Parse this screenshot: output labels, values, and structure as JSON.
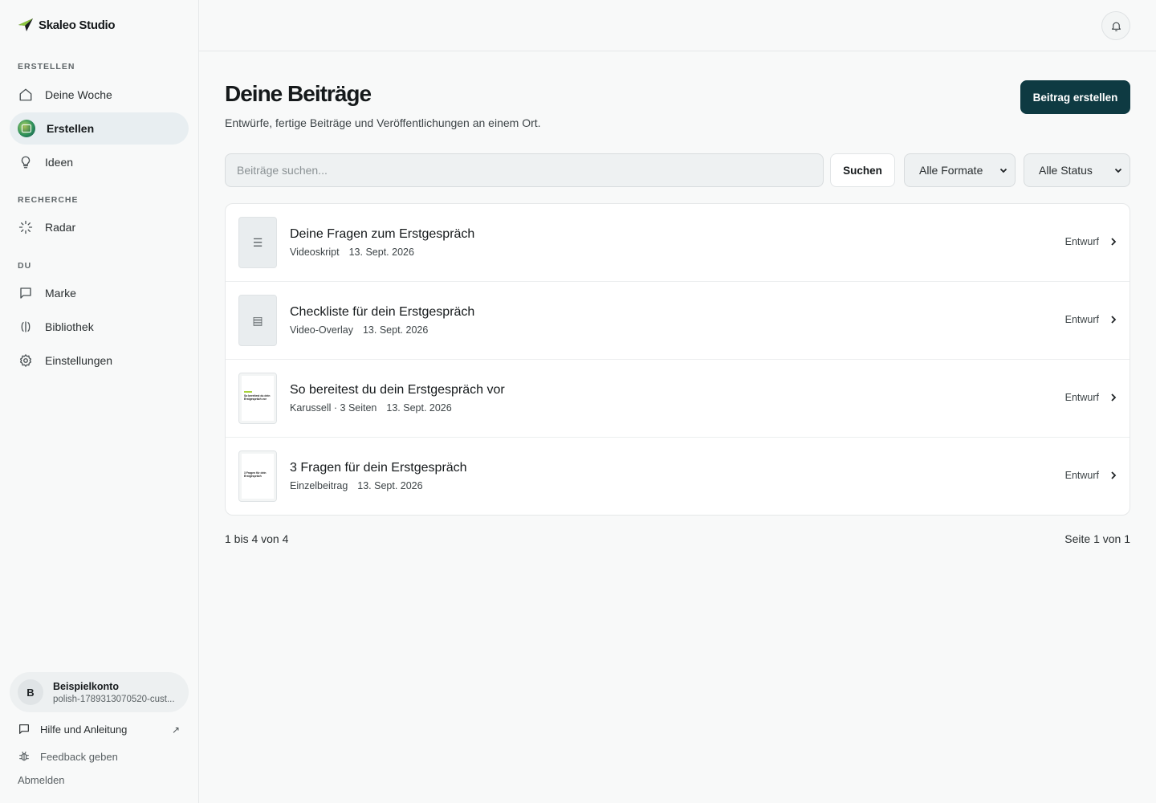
{
  "brand": {
    "name": "Skaleo Studio"
  },
  "sidebar": {
    "sections": [
      {
        "label": "ERSTELLEN",
        "items": [
          {
            "label": "Deine Woche",
            "icon": "home-icon"
          },
          {
            "label": "Erstellen",
            "icon": "create-icon",
            "active": true
          },
          {
            "label": "Ideen",
            "icon": "lightbulb-icon"
          }
        ]
      },
      {
        "label": "RECHERCHE",
        "items": [
          {
            "label": "Radar",
            "icon": "radar-icon"
          }
        ]
      },
      {
        "label": "DU",
        "items": [
          {
            "label": "Marke",
            "icon": "message-square-icon"
          },
          {
            "label": "Bibliothek",
            "icon": "library-icon"
          },
          {
            "label": "Einstellungen",
            "icon": "gear-icon"
          }
        ]
      }
    ],
    "account": {
      "initial": "B",
      "name": "Beispielkonto",
      "sub": "polish-1789313070520-cust..."
    },
    "footer": {
      "help": "Hilfe und Anleitung",
      "feedback": "Feedback geben",
      "logout": "Abmelden"
    }
  },
  "main": {
    "title": "Deine Beiträge",
    "subtitle": "Entwürfe, fertige Beiträge und Veröffentlichungen an einem Ort.",
    "create_button": "Beitrag erstellen",
    "search": {
      "placeholder": "Beiträge suchen...",
      "button": "Suchen"
    },
    "filters": {
      "format": "Alle Formate",
      "status": "Alle Status"
    },
    "posts": [
      {
        "title": "Deine Fragen zum Erstgespräch",
        "type": "Videoskript",
        "date": "13. Sept. 2026",
        "status": "Entwurf",
        "thumb": "script"
      },
      {
        "title": "Checkliste für dein Erstgespräch",
        "type": "Video-Overlay",
        "date": "13. Sept. 2026",
        "status": "Entwurf",
        "thumb": "overlay"
      },
      {
        "title": "So bereitest du dein Erstgespräch vor",
        "type": "Karussell · 3 Seiten",
        "date": "13. Sept. 2026",
        "status": "Entwurf",
        "thumb": "carousel",
        "thumb_text": "So bereitest du dein Erstgespräch vor"
      },
      {
        "title": "3 Fragen für dein Erstgespräch",
        "type": "Einzelbeitrag",
        "date": "13. Sept. 2026",
        "status": "Entwurf",
        "thumb": "single",
        "thumb_text": "3 Fragen für dein Erstgespräch"
      }
    ],
    "pager": {
      "range": "1 bis 4 von 4",
      "page": "Seite 1 von 1"
    }
  }
}
